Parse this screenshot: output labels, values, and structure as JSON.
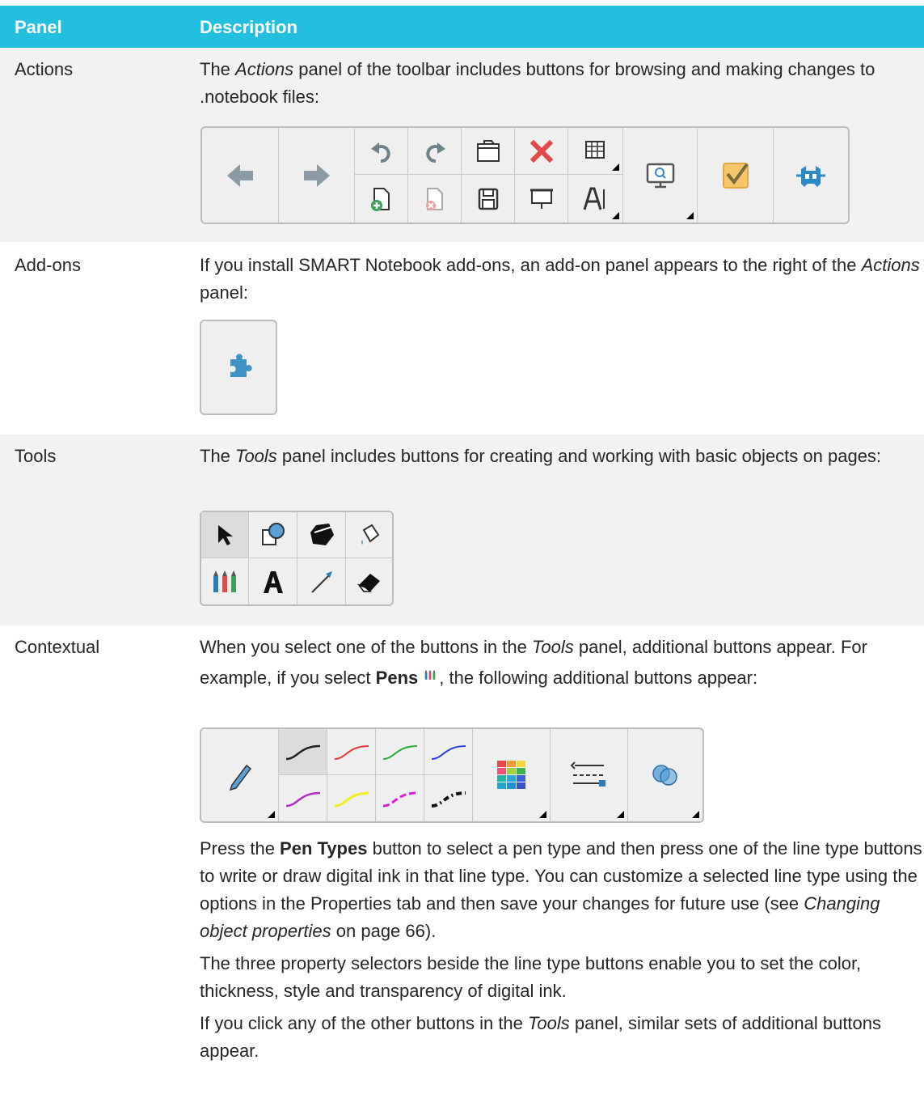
{
  "table": {
    "header": {
      "panel": "Panel",
      "description": "Description"
    },
    "rows": [
      {
        "label": "Actions",
        "desc_parts": [
          "The ",
          "Actions",
          " panel of the toolbar includes buttons for browsing and making changes to .notebook files:"
        ]
      },
      {
        "label": "Add-ons",
        "desc_parts": [
          "If you install SMART Notebook add-ons, an add-on panel appears to the right of the ",
          "Actions",
          " panel:"
        ]
      },
      {
        "label": "Tools",
        "desc_parts": [
          "The ",
          "Tools",
          " panel includes buttons for creating and working with basic objects on pages:"
        ]
      },
      {
        "label": "Contextual",
        "desc_parts": [
          "When you select one of the buttons in the ",
          "Tools",
          " panel, additional buttons appear. For example, if you select ",
          "Pens",
          ", the following additional buttons appear:"
        ],
        "para2_parts": [
          "Press the ",
          "Pen Types",
          " button to select a pen type and then press one of the line type buttons to write or draw digital ink in that line type. You can customize a selected line type using the options in the Properties tab and then save your changes for future use (see ",
          "Changing object properties",
          " on page 66)."
        ],
        "para3": "The three property selectors beside the line type buttons enable you to set the color, thickness, style and transparency of digital ink.",
        "para4_parts": [
          "If you click any of the other buttons in the ",
          "Tools",
          " panel, similar sets of additional buttons appear."
        ]
      }
    ]
  },
  "colors": {
    "header_bg": "#22bfdf",
    "row_shade": "#f2f2f2"
  }
}
